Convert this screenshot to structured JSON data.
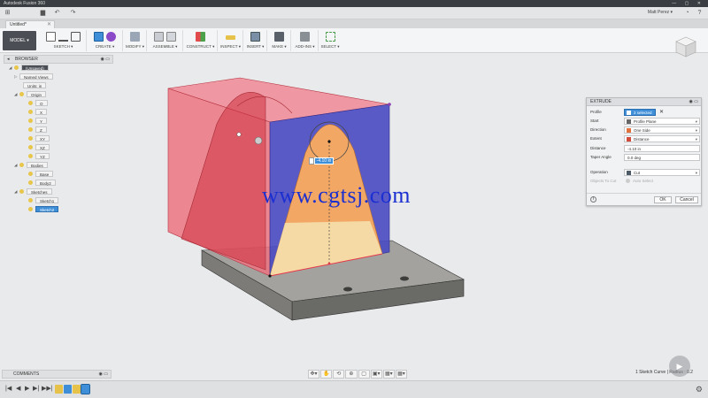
{
  "window": {
    "title": "Autodesk Fusion 360",
    "controls": "— ▢ ✕"
  },
  "qat": {
    "icons": [
      "grid-icon",
      "save-icon",
      "undo-icon",
      "redo-icon"
    ],
    "user": "Matt Perez ▾",
    "right_icons": [
      "job-status-icon",
      "help-icon"
    ]
  },
  "tab": {
    "label": "Untitled*",
    "close": "✕"
  },
  "ribbon": {
    "workspace": "MODEL ▾",
    "groups": [
      {
        "label": "SKETCH ▾"
      },
      {
        "label": "CREATE ▾"
      },
      {
        "label": "MODIFY ▾"
      },
      {
        "label": "ASSEMBLE ▾"
      },
      {
        "label": "CONSTRUCT ▾"
      },
      {
        "label": "INSPECT ▾"
      },
      {
        "label": "INSERT ▾"
      },
      {
        "label": "MAKE ▾"
      },
      {
        "label": "ADD-INS ▾"
      },
      {
        "label": "SELECT ▾"
      }
    ]
  },
  "browser": {
    "header": "BROWSER",
    "pin": "◂",
    "controls": "◉ ▭",
    "items": [
      {
        "label": "(Unsaved)",
        "expand": "◢"
      },
      {
        "label": "Named Views",
        "expand": "▷"
      },
      {
        "label": "Units: in",
        "expand": ""
      },
      {
        "label": "Origin",
        "expand": "◢"
      },
      {
        "label": "O",
        "expand": ""
      },
      {
        "label": "X",
        "expand": ""
      },
      {
        "label": "Y",
        "expand": ""
      },
      {
        "label": "Z",
        "expand": ""
      },
      {
        "label": "XY",
        "expand": ""
      },
      {
        "label": "XZ",
        "expand": ""
      },
      {
        "label": "YZ",
        "expand": ""
      },
      {
        "label": "Bodies",
        "expand": "◢"
      },
      {
        "label": "Base",
        "expand": ""
      },
      {
        "label": "Body2",
        "expand": ""
      },
      {
        "label": "Sketches",
        "expand": "◢"
      },
      {
        "label": "Sketch1",
        "expand": ""
      },
      {
        "label": "Sketch2",
        "expand": ""
      }
    ]
  },
  "dimension": {
    "value": "-4.10 in"
  },
  "watermark": "www.cgtsj.com",
  "extrude": {
    "title": "EXTRUDE",
    "header_controls": "◉ ▭",
    "rows": [
      {
        "label": "Profile",
        "value": "2 selected",
        "x": "✕"
      },
      {
        "label": "Start",
        "value": "Profile Plane"
      },
      {
        "label": "Direction",
        "value": "One Side"
      },
      {
        "label": "Extent",
        "value": "Distance"
      },
      {
        "label": "Distance",
        "value": "-4.10 in"
      },
      {
        "label": "Taper Angle",
        "value": "0.0 deg"
      },
      {
        "label": "Operation",
        "value": "Cut"
      },
      {
        "label": "Objects To Cut",
        "value": "Auto Select"
      }
    ],
    "info": "i",
    "ok": "OK",
    "cancel": "Cancel"
  },
  "comments": {
    "label": "COMMENTS",
    "controls": "◉ ▭"
  },
  "navbar": [
    "✥▾",
    "✋",
    "⟲",
    "⊕",
    "▢",
    "▣▾",
    "▦▾",
    "▦▾"
  ],
  "status": {
    "text": "1 Sketch Curve | Radius : 0.2"
  },
  "badge": "▶",
  "timeline": {
    "controls": [
      "|◀",
      "◀",
      "▶",
      "▶|",
      "▶▶|"
    ],
    "settings": "⚙"
  },
  "colors": {
    "selection_red": "#e63a4c",
    "profile_blue": "#3f3fb0",
    "profile_orange": "#f0a55a",
    "base_gray": "#7f7f7c",
    "accent_blue": "#3e8fd8"
  }
}
